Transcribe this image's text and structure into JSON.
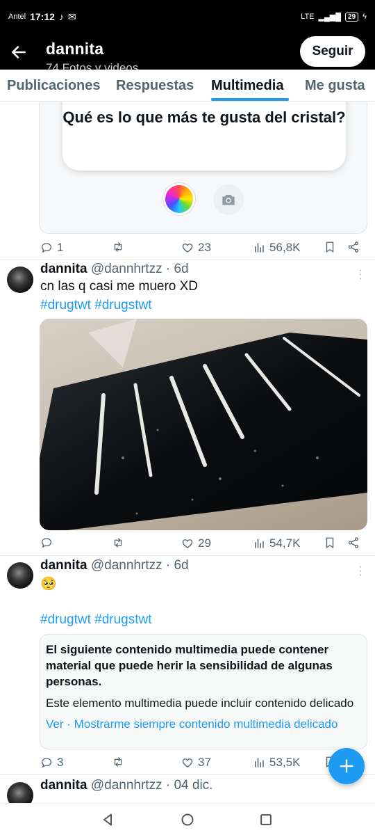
{
  "status_bar": {
    "carrier": "Antel",
    "time": "17:12",
    "network": "LTE",
    "battery": "29"
  },
  "header": {
    "title": "dannita",
    "subtitle": "74 Fotos y videos",
    "follow_label": "Seguir"
  },
  "tabs": [
    {
      "label": "Publicaciones"
    },
    {
      "label": "Respuestas"
    },
    {
      "label": "Multimedia",
      "active": true
    },
    {
      "label": "Me gusta"
    }
  ],
  "accent_color": "#1d9bf0",
  "posts": [
    {
      "poll_question": "Qué es lo que más te gusta del cristal?",
      "replies": "1",
      "reposts": "",
      "likes": "23",
      "views": "56,8K"
    },
    {
      "name": "dannita",
      "handle": "@dannhrtzz",
      "time": "· 6d",
      "text": "cn las q casi me muero XD",
      "hashtags": "#drugtwt #drugstwt",
      "media": "photo",
      "replies": "",
      "reposts": "",
      "likes": "29",
      "views": "54,7K"
    },
    {
      "name": "dannita",
      "handle": "@dannhrtzz",
      "time": "· 6d",
      "text": "🥺",
      "hashtags": "#drugtwt #drugstwt",
      "warning_title": "El siguiente contenido multimedia puede contener material que puede herir la sensibilidad de algunas personas.",
      "warning_body": "Este elemento multimedia puede incluir contenido delicado",
      "warning_link": "Ver · Mostrarme siempre contenido multimedia delicado",
      "replies": "3",
      "reposts": "",
      "likes": "37",
      "views": "53,5K"
    },
    {
      "name": "dannita",
      "handle": "@dannhrtzz",
      "time": "· 04 dic."
    }
  ]
}
